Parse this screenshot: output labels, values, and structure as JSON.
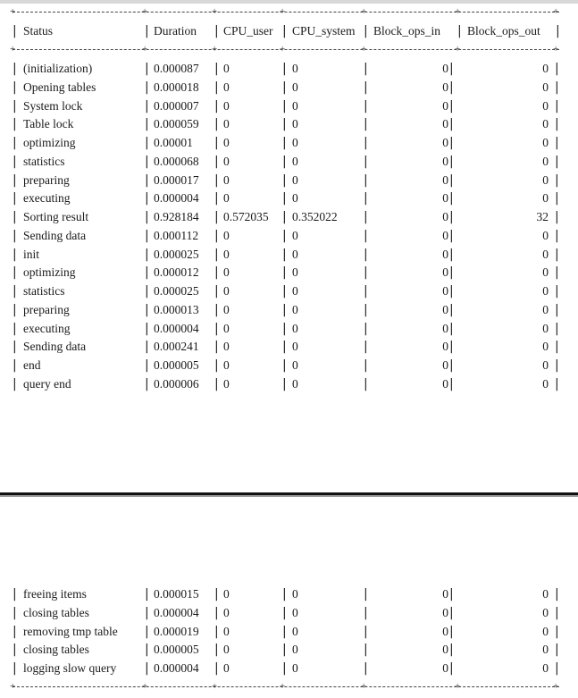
{
  "columns": [
    "Status",
    "Duration",
    "CPU_user",
    "CPU_system",
    "Block_ops_in",
    "Block_ops_out"
  ],
  "rows_top": [
    [
      "(initialization)",
      "0.000087",
      "0",
      "0",
      "0",
      "0"
    ],
    [
      "Opening tables",
      "0.000018",
      "0",
      "0",
      "0",
      "0"
    ],
    [
      "System lock",
      "0.000007",
      "0",
      "0",
      "0",
      "0"
    ],
    [
      "Table lock",
      "0.000059",
      "0",
      "0",
      "0",
      "0"
    ],
    [
      "optimizing",
      "0.00001",
      "0",
      "0",
      "0",
      "0"
    ],
    [
      "statistics",
      "0.000068",
      "0",
      "0",
      "0",
      "0"
    ],
    [
      "preparing",
      "0.000017",
      "0",
      "0",
      "0",
      "0"
    ],
    [
      "executing",
      "0.000004",
      "0",
      "0",
      "0",
      "0"
    ],
    [
      "Sorting result",
      "0.928184",
      "0.572035",
      "0.352022",
      "0",
      "32"
    ],
    [
      "Sending data",
      "0.000112",
      "0",
      "0",
      "0",
      "0"
    ],
    [
      "init",
      "0.000025",
      "0",
      "0",
      "0",
      "0"
    ],
    [
      "optimizing",
      "0.000012",
      "0",
      "0",
      "0",
      "0"
    ],
    [
      "statistics",
      "0.000025",
      "0",
      "0",
      "0",
      "0"
    ],
    [
      "preparing",
      "0.000013",
      "0",
      "0",
      "0",
      "0"
    ],
    [
      "executing",
      "0.000004",
      "0",
      "0",
      "0",
      "0"
    ],
    [
      "Sending data",
      "0.000241",
      "0",
      "0",
      "0",
      "0"
    ],
    [
      "end",
      "0.000005",
      "0",
      "0",
      "0",
      "0"
    ],
    [
      "query end",
      "0.000006",
      "0",
      "0",
      "0",
      "0"
    ]
  ],
  "rows_bottom": [
    [
      "freeing items",
      "0.000015",
      "0",
      "0",
      "0",
      "0"
    ],
    [
      "closing tables",
      "0.000004",
      "0",
      "0",
      "0",
      "0"
    ],
    [
      "removing tmp table",
      "0.000019",
      "0",
      "0",
      "0",
      "0"
    ],
    [
      "closing tables",
      "0.000005",
      "0",
      "0",
      "0",
      "0"
    ],
    [
      "logging slow query",
      "0.000004",
      "0",
      "0",
      "0",
      "0"
    ]
  ]
}
